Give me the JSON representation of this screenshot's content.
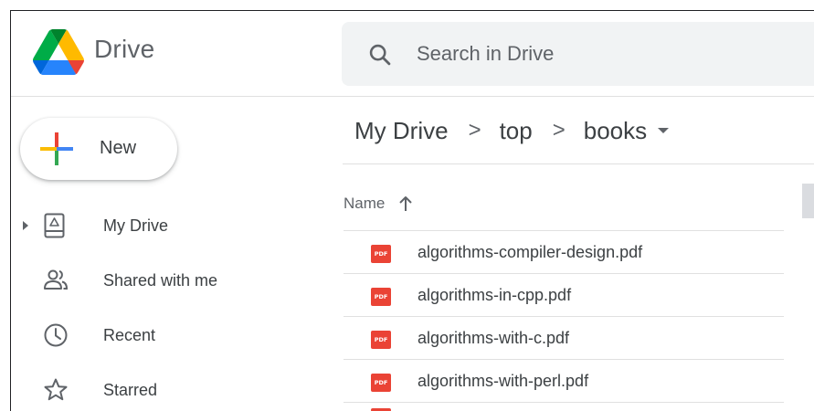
{
  "app": {
    "name": "Drive"
  },
  "search": {
    "placeholder": "Search in Drive"
  },
  "sidebar": {
    "new_label": "New",
    "items": [
      {
        "label": "My Drive",
        "icon": "my-drive-icon"
      },
      {
        "label": "Shared with me",
        "icon": "shared-icon"
      },
      {
        "label": "Recent",
        "icon": "clock-icon"
      },
      {
        "label": "Starred",
        "icon": "star-icon"
      }
    ]
  },
  "breadcrumb": {
    "items": [
      "My Drive",
      "top",
      "books"
    ],
    "separator": ">"
  },
  "file_list": {
    "column_name": "Name",
    "sort_direction": "ascending",
    "files": [
      {
        "name": "algorithms-compiler-design.pdf",
        "type_label": "PDF"
      },
      {
        "name": "algorithms-in-cpp.pdf",
        "type_label": "PDF"
      },
      {
        "name": "algorithms-with-c.pdf",
        "type_label": "PDF"
      },
      {
        "name": "algorithms-with-perl.pdf",
        "type_label": "PDF"
      }
    ]
  },
  "colors": {
    "pdf_red": "#ea4335",
    "drive_green": "#0f9d58",
    "drive_yellow": "#f4b400",
    "drive_blue": "#4285f4",
    "text_primary": "#3c4043",
    "text_secondary": "#5f6368",
    "search_bg": "#f1f3f4"
  }
}
